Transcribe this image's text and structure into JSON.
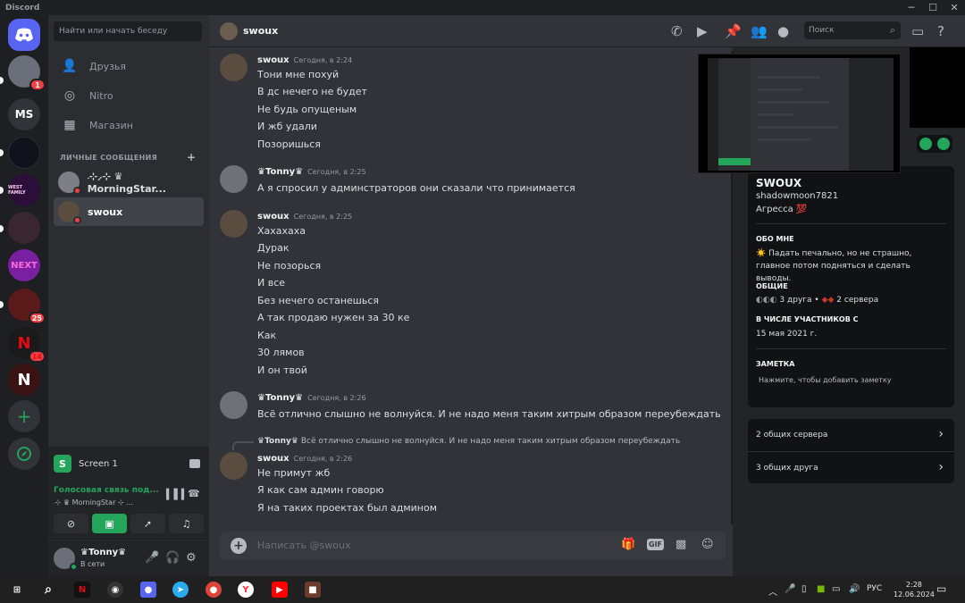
{
  "window": {
    "app_title": "Discord",
    "controls": [
      "─",
      "☐",
      "✕"
    ]
  },
  "guilds": [
    {
      "label": "",
      "badge": "1"
    },
    {
      "label": "MS",
      "badge": ""
    },
    {
      "label": "",
      "badge": ""
    },
    {
      "label": "WEST FAMILY",
      "badge": ""
    },
    {
      "label": "",
      "badge": ""
    },
    {
      "label": "NEXT",
      "badge": ""
    },
    {
      "label": "",
      "badge": "25"
    },
    {
      "label": "N",
      "badge": "14"
    },
    {
      "label": "N",
      "badge": ""
    },
    {
      "label": "+",
      "badge": ""
    },
    {
      "label": "",
      "badge": ""
    }
  ],
  "sidebar": {
    "search_placeholder": "Найти или начать беседу",
    "nav": [
      {
        "label": "Друзья"
      },
      {
        "label": "Nitro"
      },
      {
        "label": "Магазин"
      }
    ],
    "dm_header": "ЛИЧНЫЕ СООБЩЕНИЯ",
    "dms": [
      {
        "name": "܁⊹⸝⊹ ♛ MorningStar..."
      },
      {
        "name": "swoux"
      }
    ]
  },
  "voice": {
    "screen_label": "Screen 1",
    "status": "Голосовая связь под...",
    "sub": "܁⊹ ♛ MorningStar ⊹ ..."
  },
  "user": {
    "name": "♛Tonny♛",
    "status": "В сети"
  },
  "header": {
    "channel_name": "swoux",
    "search_placeholder": "Поиск"
  },
  "messages": [
    {
      "author": "swoux",
      "time": "Сегодня, в 2:24",
      "lines": [
        "Тони мне похуй",
        "В  дс нечего не будет",
        "Не будь опущеным",
        "И жб удали",
        "Позоришься"
      ]
    },
    {
      "author": "♛Tonny♛",
      "time": "Сегодня, в 2:25",
      "lines": [
        "А я спросил у админстраторов они сказали что принимается"
      ]
    },
    {
      "author": "swoux",
      "time": "Сегодня, в 2:25",
      "lines": [
        "Хахахаха",
        "Дурак",
        "Не позорься",
        "И все",
        "Без нечего останешься",
        "А так продаю нужен за 30 ке",
        "Как",
        "30 лямов",
        "И он твой"
      ]
    },
    {
      "author": "♛Tonny♛",
      "time": "Сегодня, в 2:26",
      "lines": [
        "Всё отлично слышно не волнуйся. И не надо меня таким хитрым образом переубеждать"
      ]
    },
    {
      "author": "swoux",
      "time": "Сегодня, в 2:26",
      "lines": [
        "Не примут жб",
        "Я как сам админ говорю",
        "Я на таких проектах был админом"
      ]
    }
  ],
  "reply": {
    "name": "♛Tonny♛",
    "text": "Всё отлично слышно не волнуйся. И не надо меня таким хитрым образом переубеждать"
  },
  "composer": {
    "placeholder": "Написать @swoux",
    "gif_label": "GIF"
  },
  "profile": {
    "display_name": "SWOUX",
    "username": "shadowmoon7821",
    "status": "Агресса 💯",
    "about_label": "ОБО МНЕ",
    "about_text": "☀️ Падать печально, но не страшно, главное потом подняться и сделать выводы.",
    "common_label": "ОБЩИЕ",
    "common_friends": "3 друга",
    "common_servers": "2 сервера",
    "member_since_label": "В ЧИСЛЕ УЧАСТНИКОВ С",
    "member_since": "15 мая 2021 г.",
    "note_label": "ЗАМЕТКА",
    "note_placeholder": "Нажмите, чтобы добавить заметку",
    "mutual_servers": "2 общих сервера",
    "mutual_friends": "3 общих друга"
  },
  "taskbar": {
    "lang": "РУС",
    "time": "2:28",
    "date": "12.06.2024"
  },
  "colors": {
    "accent": "#5865f2",
    "online": "#23a55a",
    "dnd": "#f23f43",
    "bg": "#313338"
  }
}
